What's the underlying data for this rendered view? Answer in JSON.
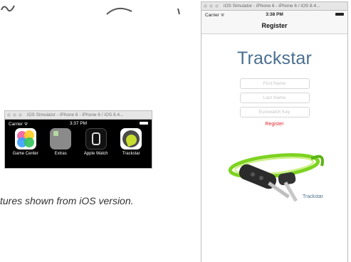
{
  "caption": "tures shown from iOS version.",
  "small_sim": {
    "window_title": "iOS Simulator - iPhone 6 - iPhone 6 / iOS 8.4...",
    "carrier": "Carrier",
    "time": "3:37 PM",
    "apps": [
      {
        "label": "Game Center",
        "icon": "game-center-icon"
      },
      {
        "label": "Extras",
        "icon": "extras-folder-icon"
      },
      {
        "label": "Apple Watch",
        "icon": "apple-watch-icon"
      },
      {
        "label": "Trackstar",
        "icon": "trackstar-icon"
      }
    ]
  },
  "large_sim": {
    "window_title": "iOS Simulator - iPhone 6 - iPhone 6 / iOS 8.4...",
    "carrier": "Carrier",
    "time": "3:38 PM",
    "nav_title": "Register",
    "app_title": "Trackstar",
    "fields": {
      "first_name_placeholder": "First Name",
      "last_name_placeholder": "Last Name",
      "key_placeholder": "Eurowatch Key"
    },
    "register_label": "Register",
    "logo_caption": "Trackstar",
    "colors": {
      "title_blue": "#4a6f8f",
      "register_red": "#e8262a",
      "logo_green": "#7ed321"
    }
  }
}
